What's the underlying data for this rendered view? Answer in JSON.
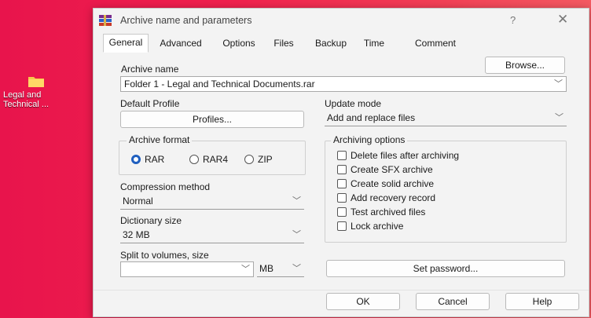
{
  "desktop": {
    "icon_label": "Legal and Technical ..."
  },
  "window": {
    "title": "Archive name and parameters",
    "help_symbol": "?",
    "close_symbol": "✕"
  },
  "tabs": [
    "General",
    "Advanced",
    "Options",
    "Files",
    "Backup",
    "Time",
    "Comment"
  ],
  "archive_name": {
    "label": "Archive name",
    "value": "Folder 1 - Legal and Technical Documents.rar",
    "browse_label": "Browse..."
  },
  "profile": {
    "label": "Default Profile",
    "button_label": "Profiles..."
  },
  "update_mode": {
    "label": "Update mode",
    "value": "Add and replace files"
  },
  "archive_format": {
    "label": "Archive format",
    "options": [
      "RAR",
      "RAR4",
      "ZIP"
    ],
    "selected": "RAR"
  },
  "compression": {
    "label": "Compression method",
    "value": "Normal"
  },
  "dictionary": {
    "label": "Dictionary size",
    "value": "32 MB"
  },
  "split": {
    "label": "Split to volumes, size",
    "value": "",
    "unit": "MB"
  },
  "archiving_options": {
    "label": "Archiving options",
    "items": [
      "Delete files after archiving",
      "Create SFX archive",
      "Create solid archive",
      "Add recovery record",
      "Test archived files",
      "Lock archive"
    ]
  },
  "set_password_label": "Set password...",
  "footer": {
    "ok": "OK",
    "cancel": "Cancel",
    "help": "Help"
  },
  "colors": {
    "accent": "#1f5fbf",
    "desktop_bg": "#e8144c"
  }
}
